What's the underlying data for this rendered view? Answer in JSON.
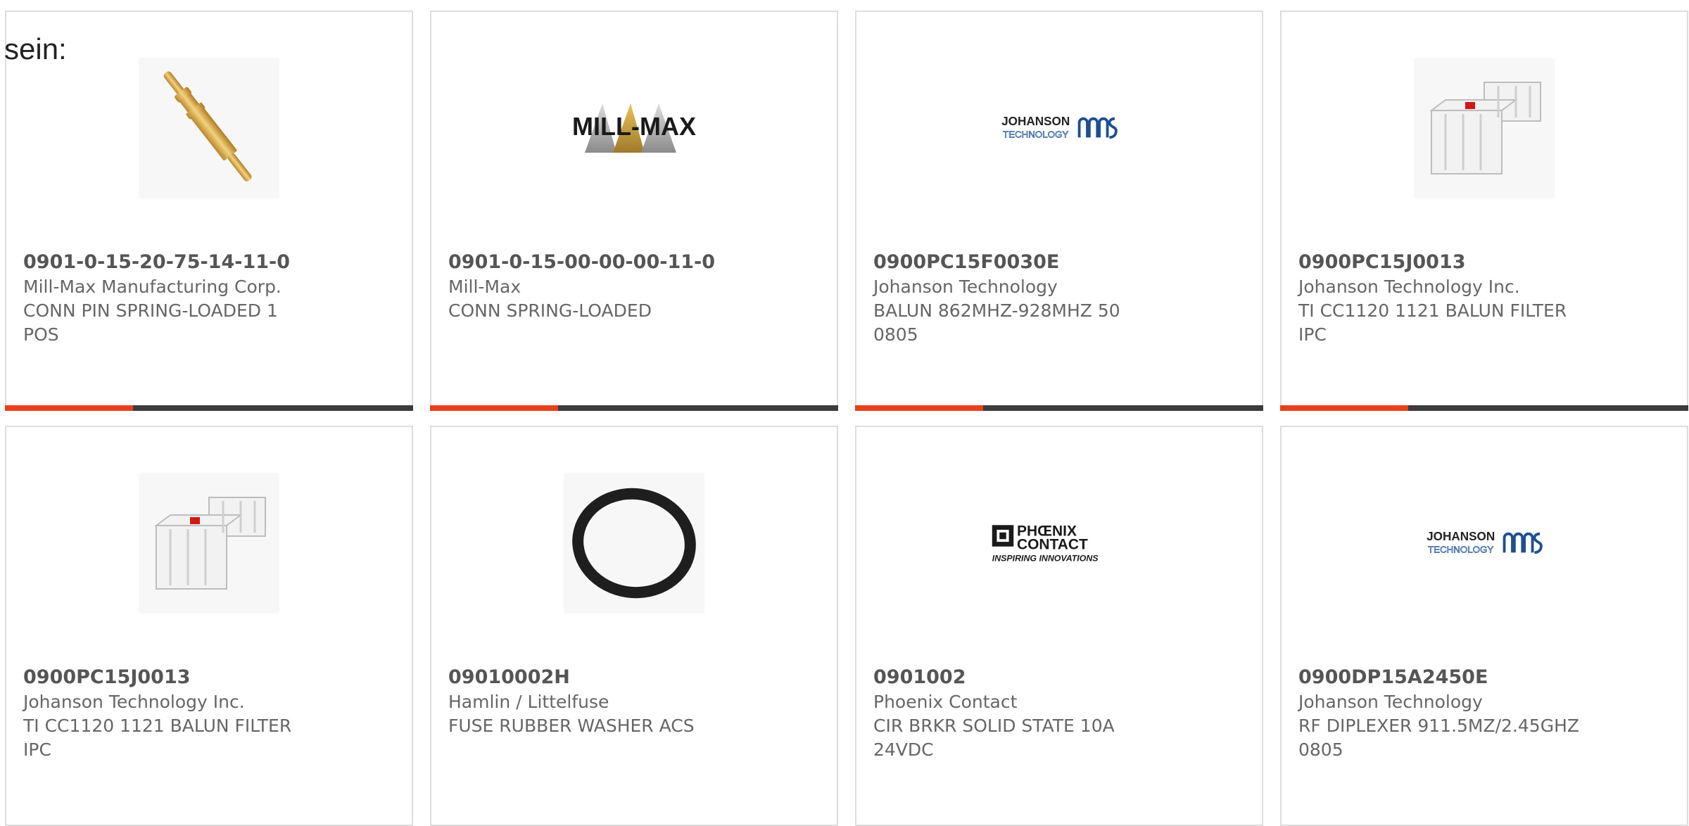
{
  "intro_text": "sein:",
  "colors": {
    "accent": "#e8401c",
    "bar": "#3c3c3c",
    "border": "#dddddd"
  },
  "products": [
    {
      "part_number": "0901-0-15-20-75-14-11-0",
      "manufacturer": "Mill-Max Manufacturing Corp.",
      "description": "CONN PIN SPRING-LOADED 1 POS",
      "image": "spring-pin-icon"
    },
    {
      "part_number": "0901-0-15-00-00-00-11-0",
      "manufacturer": "Mill-Max",
      "description": "CONN SPRING-LOADED",
      "image": "mill-max-logo"
    },
    {
      "part_number": "0900PC15F0030E",
      "manufacturer": "Johanson Technology",
      "description": "BALUN 862MHZ-928MHZ 50 0805",
      "image": "johanson-logo"
    },
    {
      "part_number": "0900PC15J0013",
      "manufacturer": "Johanson Technology Inc.",
      "description": "TI CC1120 1121 BALUN FILTER IPC",
      "image": "ceramic-chip-icon"
    },
    {
      "part_number": "0900PC15J0013",
      "manufacturer": "Johanson Technology Inc.",
      "description": "TI CC1120 1121 BALUN FILTER IPC",
      "image": "ceramic-chip-icon"
    },
    {
      "part_number": "09010002H",
      "manufacturer": "Hamlin / Littelfuse",
      "description": "FUSE RUBBER WASHER ACS",
      "image": "rubber-washer-icon"
    },
    {
      "part_number": "0901002",
      "manufacturer": "Phoenix Contact",
      "description": "CIR BRKR SOLID STATE 10A 24VDC",
      "image": "phoenix-contact-logo"
    },
    {
      "part_number": "0900DP15A2450E",
      "manufacturer": "Johanson Technology",
      "description": "RF DIPLEXER 911.5MZ/2.45GHZ 0805",
      "image": "johanson-logo"
    }
  ],
  "logos": {
    "mill_max": "MILL-MAX",
    "johanson_top": "JOHANSON",
    "johanson_bottom": "TECHNOLOGY",
    "phoenix_top": "PHŒNIX",
    "phoenix_bottom": "CONTACT",
    "phoenix_tagline": "INSPIRING INNOVATIONS"
  }
}
